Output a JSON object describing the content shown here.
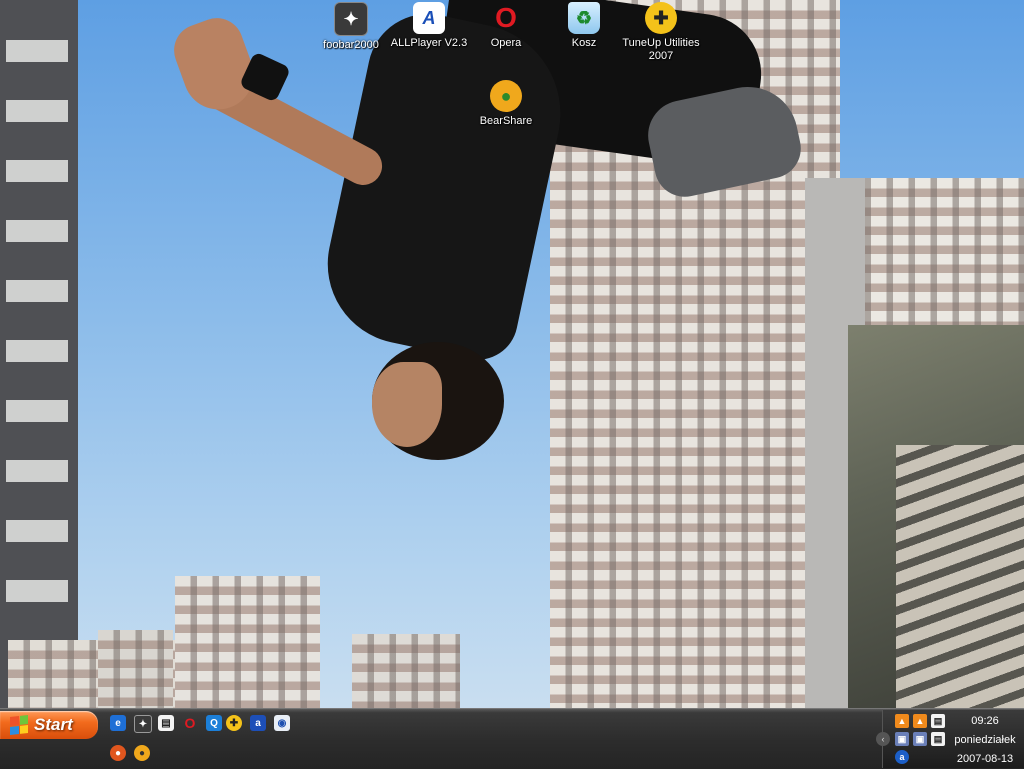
{
  "desktop": {
    "icons": [
      {
        "label": "foobar2000",
        "icon": "foobar2000-icon"
      },
      {
        "label": "ALLPlayer V2.3",
        "icon": "allplayer-icon"
      },
      {
        "label": "Opera",
        "icon": "opera-icon"
      },
      {
        "label": "Kosz",
        "icon": "recycle-bin-icon"
      },
      {
        "label": "TuneUp Utilities 2007",
        "icon": "tuneup-utilities-icon"
      },
      {
        "label": "BearShare",
        "icon": "bearshare-icon"
      }
    ]
  },
  "taskbar": {
    "start_label": "Start",
    "quick_launch": [
      "internet-explorer-icon",
      "foobar2000-icon",
      "notepad-icon",
      "opera-icon",
      "search-icon",
      "tuneup-utilities-icon",
      "allplayer-icon",
      "network-icon",
      "firefox-icon",
      "bearshare-icon"
    ],
    "tray": {
      "icons": [
        "vlc-icon",
        "vlc-icon",
        "document-icon",
        "network-icon",
        "network-icon",
        "document-icon",
        "update-icon"
      ],
      "time": "09:26",
      "day": "poniedziałek",
      "date": "2007-08-13"
    }
  },
  "colors": {
    "start_button": "#e8601a",
    "taskbar": "#2d2d2d"
  }
}
